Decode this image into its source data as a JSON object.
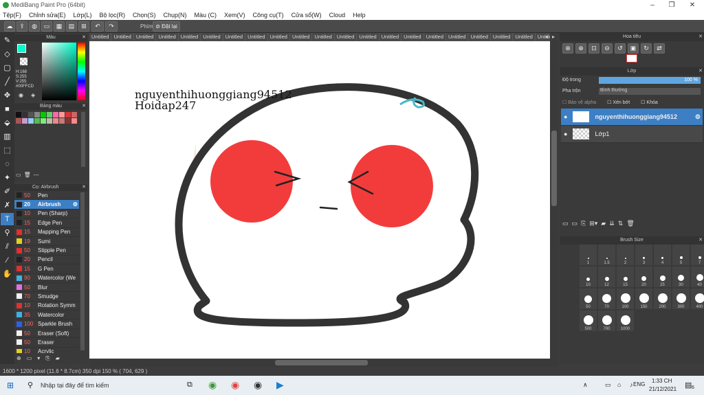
{
  "window": {
    "title": "MediBang Paint Pro (64bit)"
  },
  "menu": [
    "Tệp(F)",
    "Chỉnh sửa(E)",
    "Lớp(L)",
    "Bộ lọc(R)",
    "Chọn(S)",
    "Chụp(N)",
    "Màu (C)",
    "Xem(V)",
    "Công cụ(T)",
    "Cửa sổ(W)",
    "Cloud",
    "Help"
  ],
  "toolbar": {
    "phim_label": "Phím",
    "reset_label": "Đặt lại"
  },
  "tabs": {
    "label": "Untitled",
    "count": 23
  },
  "color_panel": {
    "title": "Màu",
    "h": "H:168",
    "s": "S:255",
    "v": "V:255",
    "hex": "#00FFCD",
    "current_color": "#00ffcd"
  },
  "palette_panel": {
    "title": "Bảng màu",
    "footer": "---"
  },
  "brush_panel": {
    "title": "Cọ: Airbrush",
    "items": [
      {
        "size": "50",
        "name": "Pen",
        "color": "#222222"
      },
      {
        "size": "20",
        "name": "Airbrush",
        "color": "#222222",
        "selected": true
      },
      {
        "size": "10",
        "name": "Pen (Sharp)",
        "color": "#222222"
      },
      {
        "size": "15",
        "name": "Edge Pen",
        "color": "#222222"
      },
      {
        "size": "15",
        "name": "Mapping Pen",
        "color": "#e03030"
      },
      {
        "size": "19",
        "name": "Sumi",
        "color": "#e0d020"
      },
      {
        "size": "50",
        "name": "Stipple Pen",
        "color": "#e03030"
      },
      {
        "size": "20",
        "name": "Pencil",
        "color": "#222222"
      },
      {
        "size": "15",
        "name": "G Pen",
        "color": "#e03030"
      },
      {
        "size": "90",
        "name": "Watercolor (We",
        "color": "#40b0e0"
      },
      {
        "size": "50",
        "name": "Blur",
        "color": "#e070e0"
      },
      {
        "size": "70",
        "name": "Smudge",
        "color": "#f0f0f0"
      },
      {
        "size": "10",
        "name": "Rotation Symm",
        "color": "#e03030"
      },
      {
        "size": "35",
        "name": "Watercolor",
        "color": "#40b0e0"
      },
      {
        "size": "100",
        "name": "Sparkle Brush",
        "color": "#3060e0"
      },
      {
        "size": "50",
        "name": "Eraser (Soft)",
        "color": "#f0f0f0"
      },
      {
        "size": "50",
        "name": "Eraser",
        "color": "#f0f0f0"
      },
      {
        "size": "10",
        "name": "Acrylic",
        "color": "#e0d020"
      }
    ]
  },
  "canvas": {
    "text_line1": "nguyenthihuonggiang94512",
    "text_line2": "Hoidap247"
  },
  "navigator": {
    "title": "Hoa tiêu"
  },
  "layer_panel": {
    "title": "Lớp",
    "opacity_label": "Độ trong",
    "opacity_value": "100 %",
    "blend_label": "Pha trộn",
    "blend_value": "Bình thường",
    "protect_alpha": "Bảo vệ alpha",
    "clipping": "Xén bớt",
    "lock": "Khóa",
    "layers": [
      {
        "name": "nguyenthihuonggiang94512",
        "selected": true
      },
      {
        "name": "Lớp1",
        "selected": false
      }
    ]
  },
  "brush_size": {
    "title": "Brush Size",
    "sizes": [
      "1",
      "1.5",
      "2",
      "3",
      "4",
      "5",
      "7",
      "10",
      "12",
      "15",
      "20",
      "25",
      "30",
      "40",
      "50",
      "70",
      "100",
      "150",
      "200",
      "300",
      "400",
      "500",
      "700",
      "1000"
    ]
  },
  "status": {
    "text": "1600 * 1200 pixel    (11.6 * 8.7cm)    350 dpi    150 %    ( 704, 629 )"
  },
  "taskbar": {
    "search_placeholder": "Nhập tại đây để tìm kiếm",
    "lang": "ENG",
    "time": "1:33 CH",
    "date": "21/12/2021",
    "notif_count": "6"
  }
}
